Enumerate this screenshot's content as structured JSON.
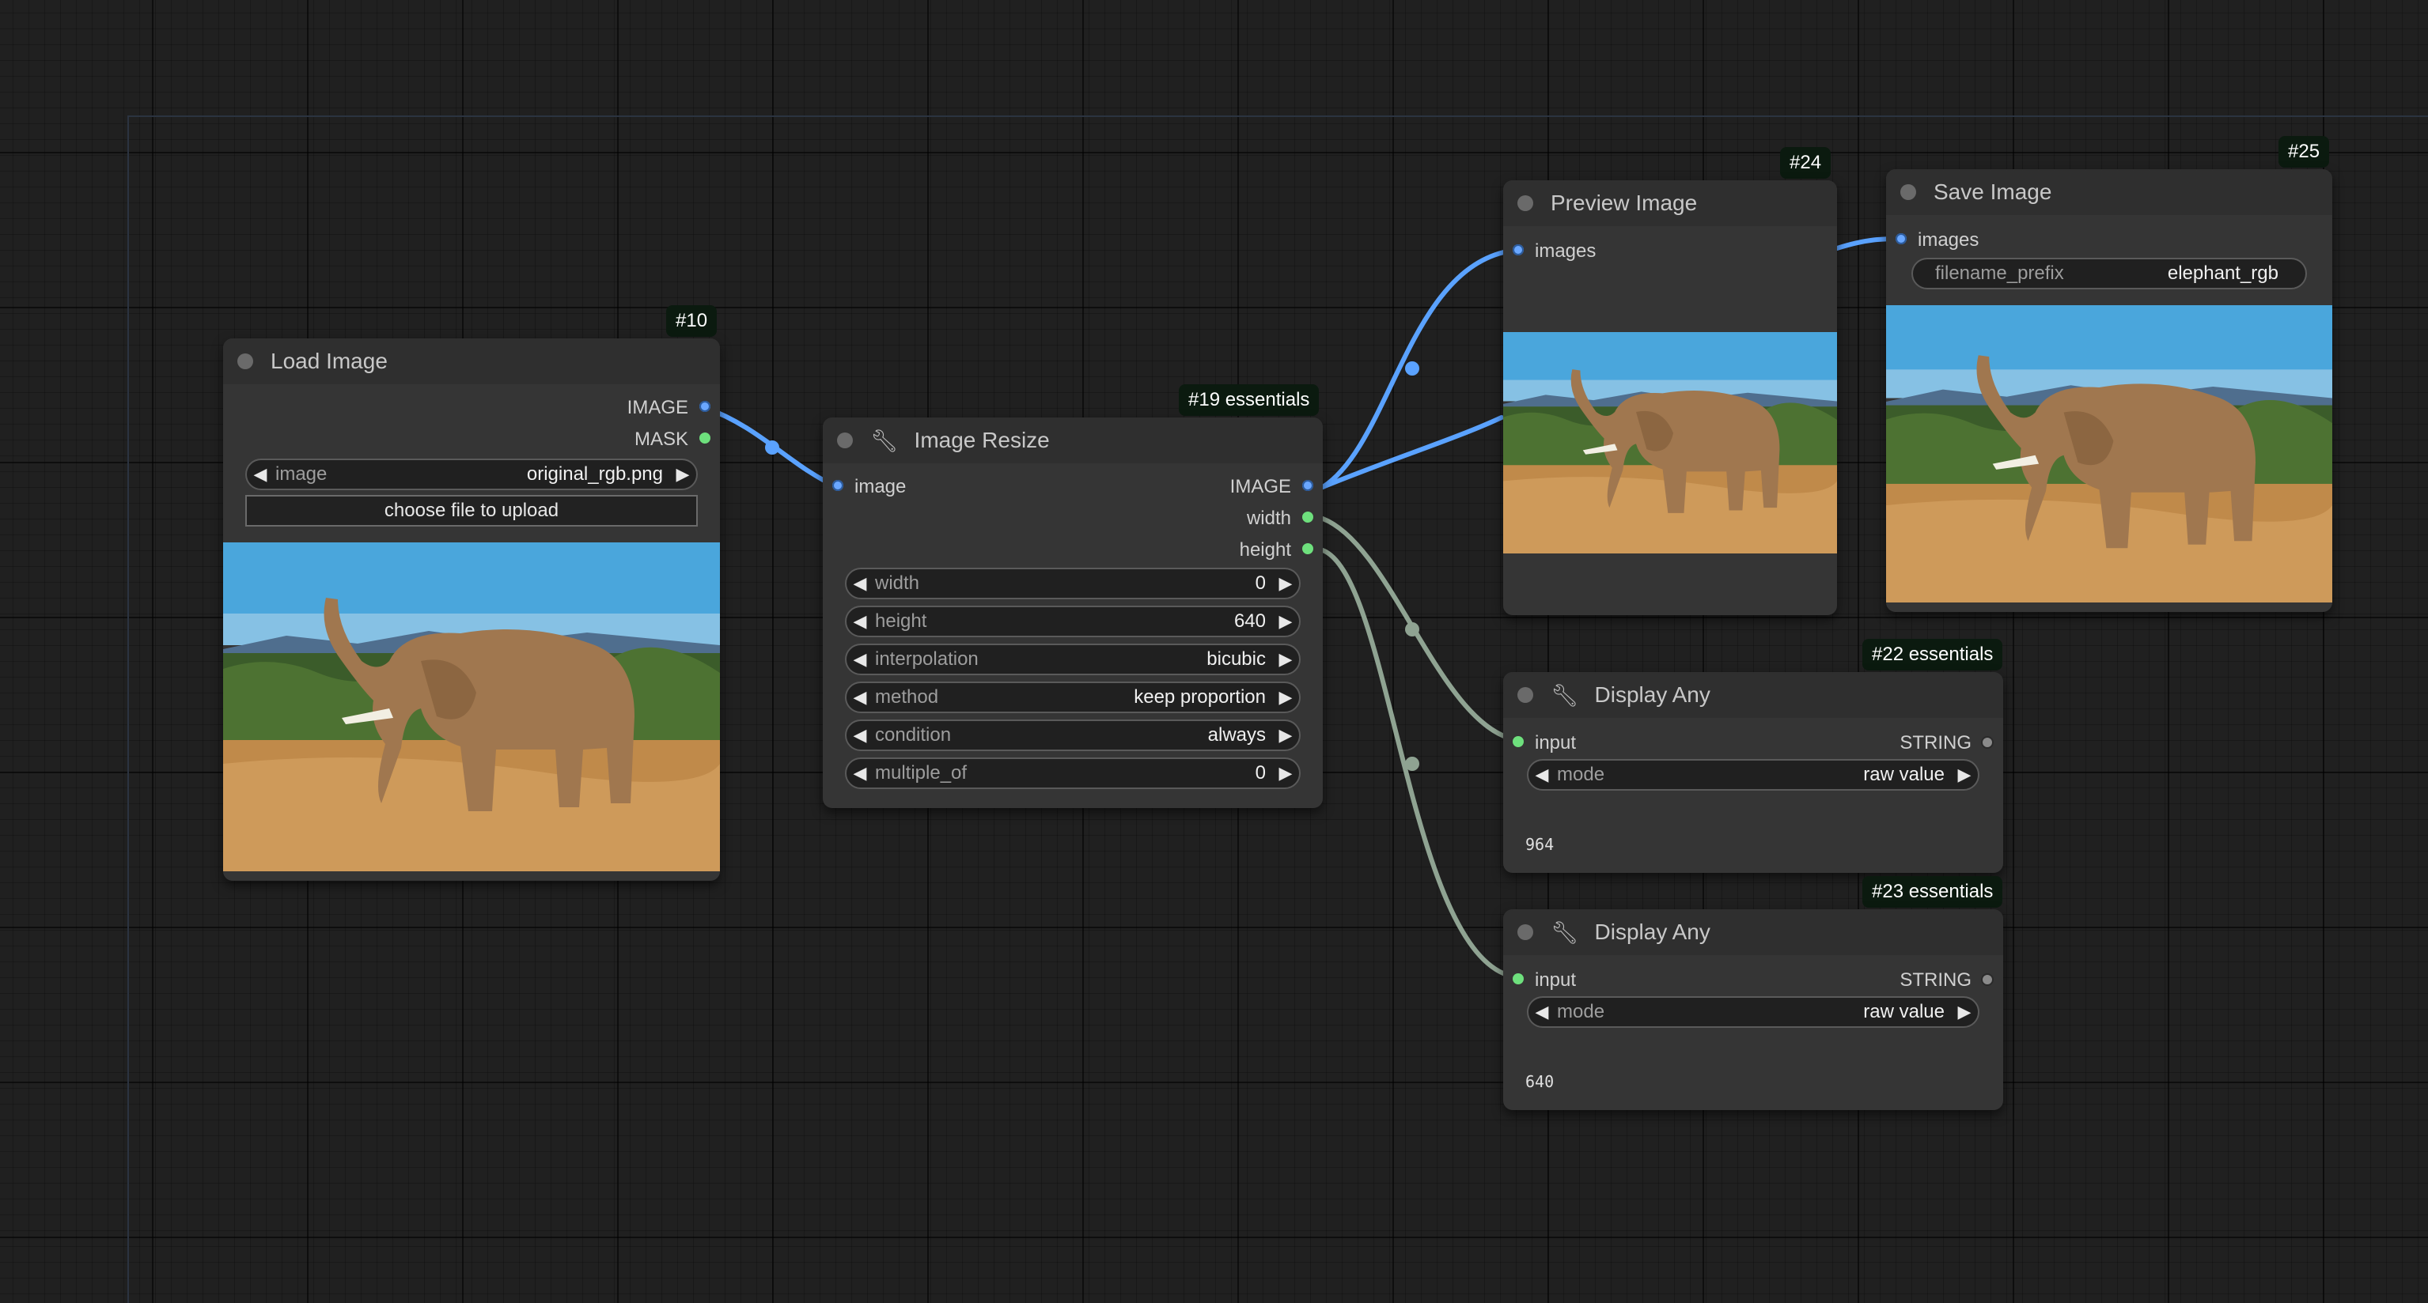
{
  "colors": {
    "image_link": "#5aa2ff",
    "int_link": "#8fa392",
    "canvas_bg": "#202020",
    "node_bg": "#353535",
    "badge_bg": "#0b1a0f"
  },
  "nodes": {
    "load_image": {
      "badge": "#10",
      "title": "Load Image",
      "outputs": [
        "IMAGE",
        "MASK"
      ],
      "image_widget": {
        "label": "image",
        "value": "original_rgb.png"
      },
      "upload_button": "choose file to upload"
    },
    "image_resize": {
      "badge": "#19 essentials",
      "title": "Image Resize",
      "icon": "wrench-icon",
      "input": "image",
      "outputs": [
        "IMAGE",
        "width",
        "height"
      ],
      "widgets": [
        {
          "label": "width",
          "value": "0"
        },
        {
          "label": "height",
          "value": "640"
        },
        {
          "label": "interpolation",
          "value": "bicubic"
        },
        {
          "label": "method",
          "value": "keep proportion"
        },
        {
          "label": "condition",
          "value": "always"
        },
        {
          "label": "multiple_of",
          "value": "0"
        }
      ]
    },
    "preview_image": {
      "badge": "#24",
      "title": "Preview Image",
      "input": "images"
    },
    "save_image": {
      "badge": "#25",
      "title": "Save Image",
      "input": "images",
      "prefix_widget": {
        "label": "filename_prefix",
        "value": "elephant_rgb"
      }
    },
    "display_any_22": {
      "badge": "#22 essentials",
      "title": "Display Any",
      "icon": "wrench-icon",
      "input": "input",
      "output": "STRING",
      "mode_widget": {
        "label": "mode",
        "value": "raw value"
      },
      "result": "964"
    },
    "display_any_23": {
      "badge": "#23 essentials",
      "title": "Display Any",
      "icon": "wrench-icon",
      "input": "input",
      "output": "STRING",
      "mode_widget": {
        "label": "mode",
        "value": "raw value"
      },
      "result": "640"
    }
  }
}
